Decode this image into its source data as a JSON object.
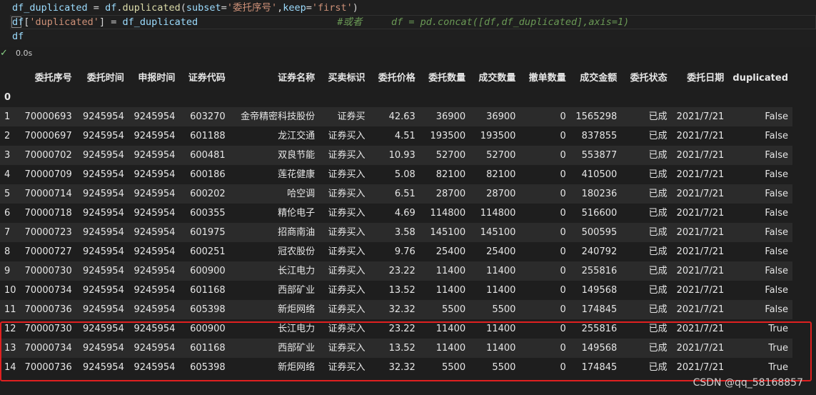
{
  "code": {
    "line1": {
      "var": "df_duplicated",
      "op": " = ",
      "obj": "df",
      "dot": ".",
      "fn": "duplicated",
      "open": "(",
      "arg1": "subset",
      "eq1": "=",
      "str1": "'委托序号'",
      "comma": ",",
      "arg2": "keep",
      "eq2": "=",
      "str2": "'first'",
      "close": ")"
    },
    "line2": {
      "obj": "df",
      "open": "[",
      "str": "'duplicated'",
      "close": "]",
      "op": " = ",
      "var": "df_duplicated",
      "comment": "#或者     df = pd.concat([df,df_duplicated],axis=1)"
    },
    "line3": {
      "obj": "df"
    }
  },
  "status": {
    "icon": "check-icon",
    "time": "0.0s"
  },
  "table": {
    "columns": [
      "委托序号",
      "委托时间",
      "申报时间",
      "证券代码",
      "证券名称",
      "买卖标识",
      "委托价格",
      "委托数量",
      "成交数量",
      "撤单数量",
      "成交金额",
      "委托状态",
      "委托日期",
      "duplicated"
    ],
    "index_name": "0",
    "rows": [
      {
        "idx": "1",
        "cells": [
          "70000693",
          "9245954",
          "9245954",
          "603270",
          "金帝精密科技股份",
          "证券买",
          "42.63",
          "36900",
          "36900",
          "0",
          "1565298",
          "已成",
          "2021/7/21",
          "False"
        ]
      },
      {
        "idx": "2",
        "cells": [
          "70000697",
          "9245954",
          "9245954",
          "601188",
          "龙江交通",
          "证券买入",
          "4.51",
          "193500",
          "193500",
          "0",
          "837855",
          "已成",
          "2021/7/21",
          "False"
        ]
      },
      {
        "idx": "3",
        "cells": [
          "70000702",
          "9245954",
          "9245954",
          "600481",
          "双良节能",
          "证券买入",
          "10.93",
          "52700",
          "52700",
          "0",
          "553877",
          "已成",
          "2021/7/21",
          "False"
        ]
      },
      {
        "idx": "4",
        "cells": [
          "70000709",
          "9245954",
          "9245954",
          "600186",
          "莲花健康",
          "证券买入",
          "5.08",
          "82100",
          "82100",
          "0",
          "410500",
          "已成",
          "2021/7/21",
          "False"
        ]
      },
      {
        "idx": "5",
        "cells": [
          "70000714",
          "9245954",
          "9245954",
          "600202",
          "哈空调",
          "证券买入",
          "6.51",
          "28700",
          "28700",
          "0",
          "180236",
          "已成",
          "2021/7/21",
          "False"
        ]
      },
      {
        "idx": "6",
        "cells": [
          "70000718",
          "9245954",
          "9245954",
          "600355",
          "精伦电子",
          "证券买入",
          "4.69",
          "114800",
          "114800",
          "0",
          "516600",
          "已成",
          "2021/7/21",
          "False"
        ]
      },
      {
        "idx": "7",
        "cells": [
          "70000723",
          "9245954",
          "9245954",
          "601975",
          "招商南油",
          "证券买入",
          "3.58",
          "145100",
          "145100",
          "0",
          "500595",
          "已成",
          "2021/7/21",
          "False"
        ]
      },
      {
        "idx": "8",
        "cells": [
          "70000727",
          "9245954",
          "9245954",
          "600251",
          "冠农股份",
          "证券买入",
          "9.76",
          "25400",
          "25400",
          "0",
          "240792",
          "已成",
          "2021/7/21",
          "False"
        ]
      },
      {
        "idx": "9",
        "cells": [
          "70000730",
          "9245954",
          "9245954",
          "600900",
          "长江电力",
          "证券买入",
          "23.22",
          "11400",
          "11400",
          "0",
          "255816",
          "已成",
          "2021/7/21",
          "False"
        ]
      },
      {
        "idx": "10",
        "cells": [
          "70000734",
          "9245954",
          "9245954",
          "601168",
          "西部矿业",
          "证券买入",
          "13.52",
          "11400",
          "11400",
          "0",
          "149568",
          "已成",
          "2021/7/21",
          "False"
        ]
      },
      {
        "idx": "11",
        "cells": [
          "70000736",
          "9245954",
          "9245954",
          "605398",
          "新炬网络",
          "证券买入",
          "32.32",
          "5500",
          "5500",
          "0",
          "174845",
          "已成",
          "2021/7/21",
          "False"
        ]
      },
      {
        "idx": "12",
        "cells": [
          "70000730",
          "9245954",
          "9245954",
          "600900",
          "长江电力",
          "证券买入",
          "23.22",
          "11400",
          "11400",
          "0",
          "255816",
          "已成",
          "2021/7/21",
          "True"
        ]
      },
      {
        "idx": "13",
        "cells": [
          "70000734",
          "9245954",
          "9245954",
          "601168",
          "西部矿业",
          "证券买入",
          "13.52",
          "11400",
          "11400",
          "0",
          "149568",
          "已成",
          "2021/7/21",
          "True"
        ]
      },
      {
        "idx": "14",
        "cells": [
          "70000736",
          "9245954",
          "9245954",
          "605398",
          "新炬网络",
          "证券买入",
          "32.32",
          "5500",
          "5500",
          "0",
          "174845",
          "已成",
          "2021/7/21",
          "True"
        ]
      }
    ]
  },
  "highlight": {
    "color": "#e02020"
  },
  "watermark": "CSDN @qq_58168857"
}
